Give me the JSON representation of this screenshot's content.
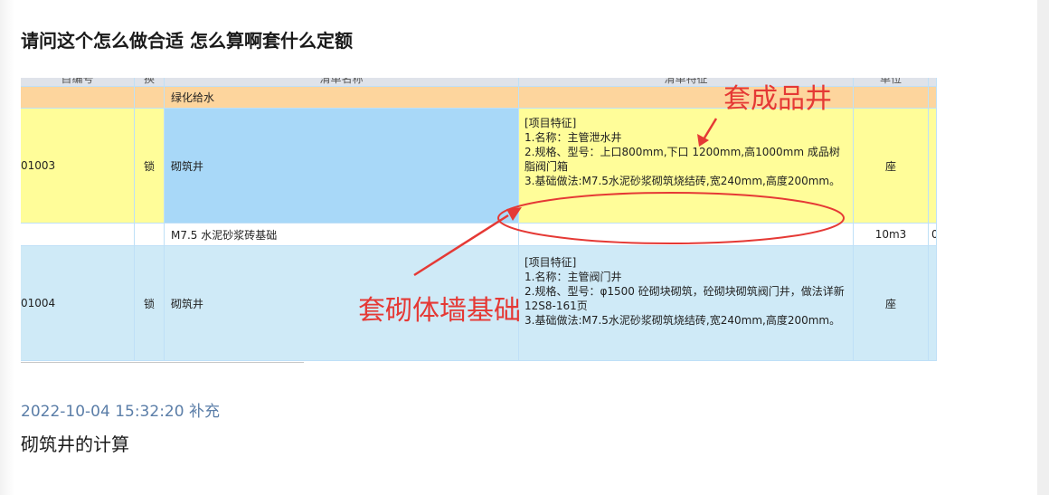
{
  "question": {
    "title": "请问这个怎么做合适 怎么算啊套什么定额"
  },
  "table": {
    "headers": [
      "目编号",
      "换",
      "清单名称",
      "清单特征",
      "单位"
    ],
    "rows": [
      {
        "code": "",
        "huan": "",
        "name": "绿化给水",
        "feature": "",
        "unit": "",
        "extra": ""
      },
      {
        "code": "01003",
        "huan": "锁",
        "name": "砌筑井",
        "feature": "[项目特征]\n1.名称：主管泄水井\n2.规格、型号：上口800mm,下口 1200mm,高1000mm 成品树脂阀门箱\n3.基础做法:M7.5水泥砂浆砌筑烧结砖,宽240mm,高度200mm。",
        "unit": "座",
        "extra": ""
      },
      {
        "code": "",
        "huan": "",
        "name": "M7.5 水泥砂浆砖基础",
        "feature": "",
        "unit": "10m3",
        "extra": "0"
      },
      {
        "code": "01004",
        "huan": "锁",
        "name": "砌筑井",
        "feature": "[项目特征]\n1.名称：主管阀门井\n2.规格、型号：φ1500 砼砌块砌筑，砼砌块砌筑阀门井，做法详新12S8-161页\n3.基础做法:M7.5水泥砂浆砌筑烧结砖,宽240mm,高度200mm。",
        "unit": "座",
        "extra": ""
      }
    ]
  },
  "annotations": {
    "label_top": "套成品井",
    "label_mid": "套砌体墙基础"
  },
  "colors": {
    "accent_red": "#e53935",
    "row_yellow": "#fffd99",
    "row_blue": "#cfeaf7",
    "selected_blue": "#a8d8f8",
    "orange_group": "#fdd59d"
  },
  "supplement": {
    "time": "2022-10-04 15:32:20 补充",
    "content": "砌筑井的计算"
  }
}
